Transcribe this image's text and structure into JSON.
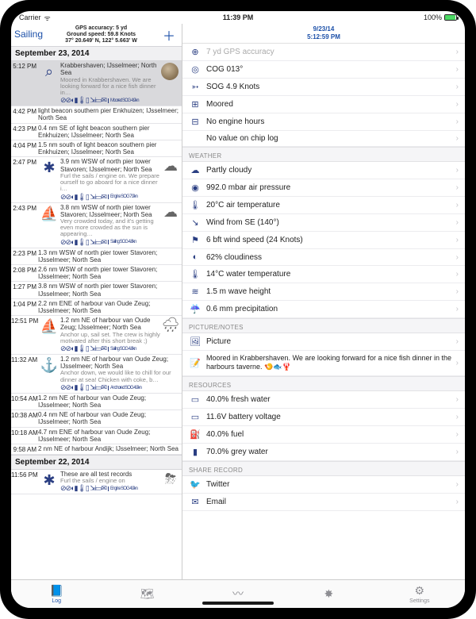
{
  "status": {
    "carrier": "Carrier",
    "wifi": "▾",
    "time": "11:39 PM",
    "battery": "100%"
  },
  "left_header": {
    "title": "Sailing",
    "gps_line1": "GPS accuracy: 5 yd",
    "gps_line2": "Ground speed: 59.8 Knots",
    "gps_line3": "37° 20.649' N, 122° 5.663' W"
  },
  "right_header": {
    "date": "9/23/14",
    "time": "5:12:59 PM"
  },
  "dates": [
    "September 23, 2014",
    "September 22, 2014"
  ],
  "entries_day1": [
    {
      "time": "5:12 PM",
      "loc": "Krabbershaven; IJsselmeer; North Sea",
      "note": "Moored in Krabbershaven. We are looking forward for a nice fish dinner in…",
      "big": "reel",
      "badge": "Moored SOG 4.9kn",
      "thumb": true
    },
    {
      "time": "4:42 PM",
      "loc": "light beacon southern pier Enkhuizen; IJsselmeer; North Sea"
    },
    {
      "time": "4:23 PM",
      "loc": "0.4 nm SE of light beacon southern pier Enkhuizen; IJsselmeer; North Sea"
    },
    {
      "time": "4:04 PM",
      "loc": "1.5 nm south of light beacon southern pier Enkhuizen; IJsselmeer; North Sea"
    },
    {
      "time": "2:47 PM",
      "loc": "3.9 nm WSW of north pier tower Stavoren; IJsselmeer; North Sea",
      "note": "Furl the sails / engine on. We prepare ourself to go aboard for a nice dinner i…",
      "big": "prop",
      "w": "☁",
      "badge": "Engine SOG 7.9kn"
    },
    {
      "time": "2:43 PM",
      "loc": "3.8 nm WSW of north pier tower Stavoren; IJsselmeer; North Sea",
      "note": "Very crowded today, and it's getting even more crowded as the sun is appearing…",
      "big": "sail",
      "w": "☁",
      "badge": "Sailing SOG 4.8kn"
    },
    {
      "time": "2:23 PM",
      "loc": "1.3 nm WSW of north pier tower Stavoren; IJsselmeer; North Sea"
    },
    {
      "time": "2:08 PM",
      "loc": "2.6 nm WSW of north pier tower Stavoren; IJsselmeer; North Sea"
    },
    {
      "time": "1:27 PM",
      "loc": "3.8 nm WSW of north pier tower Stavoren; IJsselmeer; North Sea"
    },
    {
      "time": "1:04 PM",
      "loc": "2.2 nm ENE of harbour van Oude Zeug; IJsselmeer; North Sea"
    },
    {
      "time": "12:51 PM",
      "loc": "1.2 nm NE of harbour van Oude Zeug; IJsselmeer; North Sea",
      "note": "Anchor up, sail set. The crew is highly motivated after this short break ;)",
      "big": "sail",
      "w": "🌧",
      "badge": "Sailing SOG 4.8kn"
    },
    {
      "time": "11:32 AM",
      "loc": "1.2 nm NE of harbour van Oude Zeug; IJsselmeer; North Sea",
      "note": "Anchor down, we would like to chill for our dinner at sea! Chicken with coke, b…",
      "big": "anchor",
      "badge": "Anchored SOG 4.9kn"
    },
    {
      "time": "10:54 AM",
      "loc": "1.2 nm NE of harbour van Oude Zeug; IJsselmeer; North Sea"
    },
    {
      "time": "10:38 AM",
      "loc": "0.4 nm NE of harbour van Oude Zeug; IJsselmeer; North Sea"
    },
    {
      "time": "10:18 AM",
      "loc": "4.7 nm ENE of harbour van Oude Zeug; IJsselmeer; North Sea"
    },
    {
      "time": "9:58 AM",
      "loc": "2 nm NE of harbour Andijk; IJsselmeer; North Sea"
    }
  ],
  "entries_day2": [
    {
      "time": "11:56 PM",
      "loc": "These are all test records",
      "note": "Furl the sails / engine on",
      "big": "prop",
      "w": "⛈",
      "badge": "Engine SOG 4.9kn"
    }
  ],
  "icon_strip": "⊘⊘◐▮🌡▯ ⇲▭✉",
  "detail_top": [
    {
      "ico": "⊕",
      "txt": "7 yd GPS accuracy",
      "dim": true
    },
    {
      "ico": "◎",
      "txt": "COG 013°"
    },
    {
      "ico": "➳",
      "txt": "SOG 4.9 Knots"
    },
    {
      "ico": "⊞",
      "txt": "Moored"
    },
    {
      "ico": "⊟",
      "txt": "No engine hours"
    },
    {
      "ico": "",
      "txt": "No value on chip log"
    }
  ],
  "weather_hdr": "WEATHER",
  "weather": [
    {
      "ico": "☁",
      "txt": "Partly cloudy"
    },
    {
      "ico": "◉",
      "txt": "992.0 mbar air pressure"
    },
    {
      "ico": "🌡",
      "txt": "20°C air temperature"
    },
    {
      "ico": "↘",
      "txt": "Wind from SE (140°)"
    },
    {
      "ico": "⚑",
      "txt": "6 bft wind speed (24 Knots)"
    },
    {
      "ico": "◐",
      "txt": "62% cloudiness"
    },
    {
      "ico": "🌡",
      "txt": "14°C water temperature"
    },
    {
      "ico": "≋",
      "txt": "1.5 m wave height"
    },
    {
      "ico": "☔",
      "txt": "0.6 mm precipitation"
    }
  ],
  "picnotes_hdr": "PICTURE/NOTES",
  "picnotes": [
    {
      "ico": "🖼",
      "txt": "Picture"
    },
    {
      "ico": "📝",
      "txt": "Moored in Krabbershaven. We are looking forward for a nice fish dinner in the harbours taverne. 🍤🐟🦞",
      "note": true
    }
  ],
  "resources_hdr": "RESOURCES",
  "resources": [
    {
      "ico": "▭",
      "txt": "40.0% fresh water"
    },
    {
      "ico": "▭",
      "txt": "11.6V battery voltage"
    },
    {
      "ico": "⛽",
      "txt": "40.0% fuel"
    },
    {
      "ico": "▮",
      "txt": "70.0% grey water"
    }
  ],
  "share_hdr": "SHARE RECORD",
  "share": [
    {
      "ico": "🐦",
      "txt": "Twitter"
    },
    {
      "ico": "✉",
      "txt": "Email"
    }
  ],
  "tabs": [
    {
      "ico": "📘",
      "label": "Log",
      "active": true
    },
    {
      "ico": "🗺",
      "label": ""
    },
    {
      "ico": "〰",
      "label": ""
    },
    {
      "ico": "✸",
      "label": ""
    },
    {
      "ico": "⚙",
      "label": "Settings"
    }
  ]
}
